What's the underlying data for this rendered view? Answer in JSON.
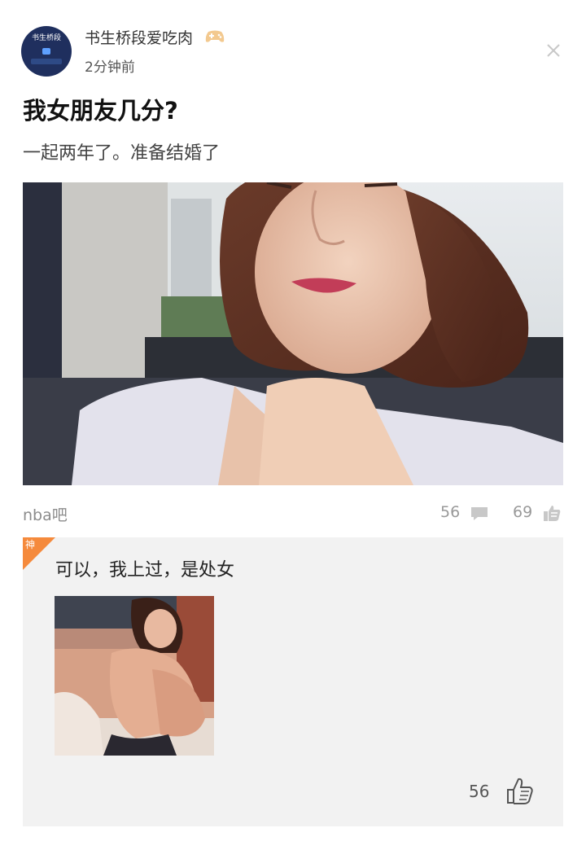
{
  "header": {
    "avatar_text": "书生桥段",
    "username": "书生桥段爱吃肉",
    "time": "2分钟前"
  },
  "post": {
    "title": "我女朋友几分?",
    "subtitle": "一起两年了。准备结婚了",
    "forum": "nba吧",
    "comments": "56",
    "likes": "69"
  },
  "reply": {
    "badge": "神",
    "text": "可以，我上过，是处女",
    "likes": "56"
  },
  "icons": {
    "badge": "gamepad-icon",
    "close": "close-icon",
    "comment": "comment-icon",
    "like": "like-icon",
    "reply_like": "thumbs-up-icon"
  },
  "colors": {
    "god_badge": "#f58a3c",
    "meta_text": "#999999",
    "reply_bg": "#f2f2f2"
  }
}
